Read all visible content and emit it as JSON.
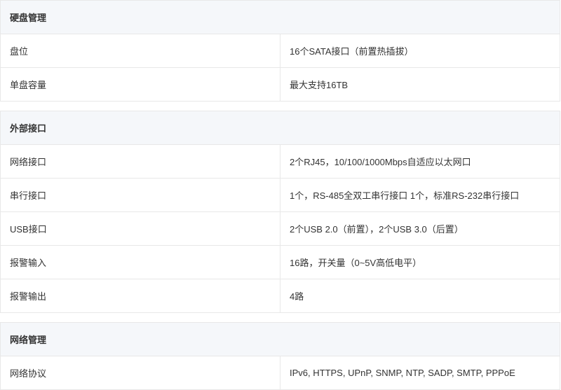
{
  "sections": [
    {
      "title": "硬盘管理",
      "rows": [
        {
          "label": "盘位",
          "value": "16个SATA接口（前置热插拔）"
        },
        {
          "label": "单盘容量",
          "value": "最大支持16TB"
        }
      ]
    },
    {
      "title": "外部接口",
      "rows": [
        {
          "label": "网络接口",
          "value": "2个RJ45，10/100/1000Mbps自适应以太网口"
        },
        {
          "label": "串行接口",
          "value": "1个，RS-485全双工串行接口 1个，标准RS-232串行接口"
        },
        {
          "label": "USB接口",
          "value": "2个USB 2.0（前置），2个USB 3.0（后置）"
        },
        {
          "label": "报警输入",
          "value": "16路，开关量（0~5V高低电平）"
        },
        {
          "label": "报警输出",
          "value": "4路"
        }
      ]
    },
    {
      "title": "网络管理",
      "rows": [
        {
          "label": "网络协议",
          "value": "IPv6, HTTPS, UPnP, SNMP, NTP, SADP, SMTP, PPPoE"
        }
      ]
    }
  ]
}
